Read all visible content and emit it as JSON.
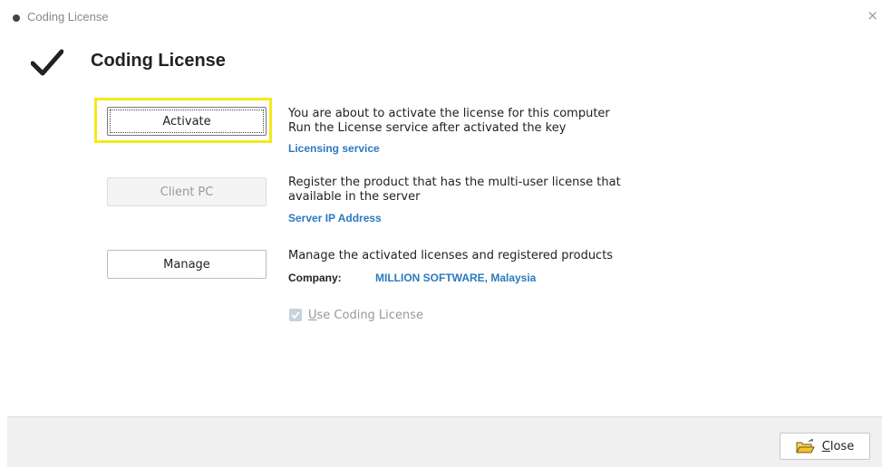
{
  "window": {
    "title": "Coding License",
    "close_glyph": "×"
  },
  "heading": "Coding License",
  "icons": {
    "title": "circle-icon",
    "check": "checkmark-icon",
    "close": "close-icon",
    "folder": "folder-open-icon"
  },
  "colors": {
    "highlight": "#f2ea1d",
    "link": "#2a7ac0"
  },
  "activate": {
    "button_label": "Activate",
    "desc_line1": "You are about to activate the license for this computer",
    "desc_line2": "Run the License service after activated the key",
    "link": "Licensing service"
  },
  "client": {
    "button_label": "Client PC",
    "desc_line1": "Register the product that has the multi-user license that",
    "desc_line2": "available in the server",
    "link": "Server IP Address"
  },
  "manage": {
    "button_label": "Manage",
    "desc_line1": "Manage the activated licenses and registered products",
    "company_label": "Company:",
    "company_value": "MILLION SOFTWARE, Malaysia"
  },
  "use_license": {
    "label_first": "U",
    "label_rest": "se Coding License",
    "checked": true
  },
  "footer": {
    "close_first": "C",
    "close_rest": "lose"
  }
}
